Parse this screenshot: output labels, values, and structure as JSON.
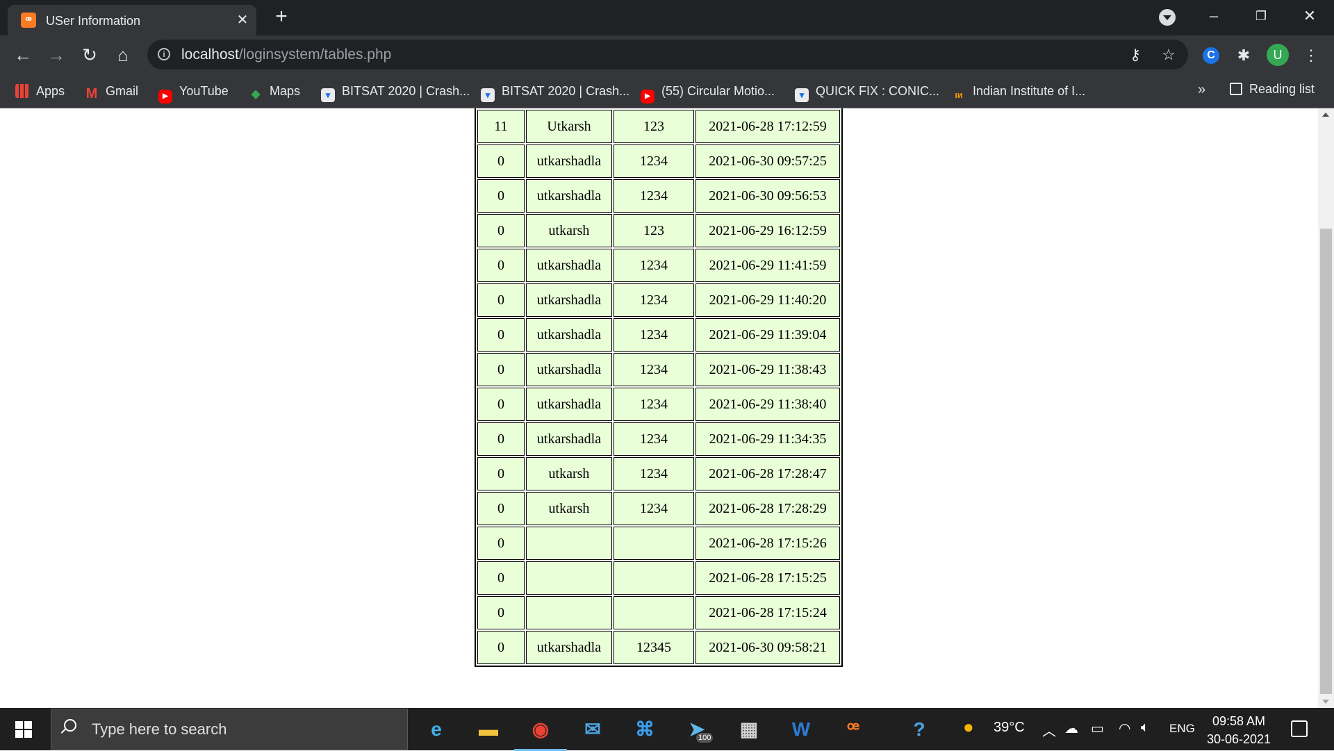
{
  "browser": {
    "tab": {
      "title": "USer Information"
    },
    "address": {
      "host": "localhost",
      "path": "/loginsystem/tables.php"
    },
    "bookmarks": [
      {
        "label": "Apps",
        "icon": "apps-grid-icon"
      },
      {
        "label": "Gmail",
        "icon": "gmail-icon"
      },
      {
        "label": "YouTube",
        "icon": "youtube-icon"
      },
      {
        "label": "Maps",
        "icon": "maps-icon"
      },
      {
        "label": "BITSAT 2020 | Crash...",
        "icon": "bookmark-site-icon"
      },
      {
        "label": "BITSAT 2020 | Crash...",
        "icon": "bookmark-site-icon"
      },
      {
        "label": "(55) Circular Motio...",
        "icon": "youtube-icon"
      },
      {
        "label": "QUICK FIX : CONIC...",
        "icon": "bookmark-site-icon"
      },
      {
        "label": "Indian Institute of I...",
        "icon": "iit-icon"
      }
    ],
    "bookmarks_more": "»",
    "reading_list": "Reading list",
    "profile_initial": "U"
  },
  "table": {
    "rows": [
      [
        "11",
        "Utkarsh",
        "123",
        "2021-06-28 17:12:59"
      ],
      [
        "0",
        "utkarshadla",
        "1234",
        "2021-06-30 09:57:25"
      ],
      [
        "0",
        "utkarshadla",
        "1234",
        "2021-06-30 09:56:53"
      ],
      [
        "0",
        "utkarsh",
        "123",
        "2021-06-29 16:12:59"
      ],
      [
        "0",
        "utkarshadla",
        "1234",
        "2021-06-29 11:41:59"
      ],
      [
        "0",
        "utkarshadla",
        "1234",
        "2021-06-29 11:40:20"
      ],
      [
        "0",
        "utkarshadla",
        "1234",
        "2021-06-29 11:39:04"
      ],
      [
        "0",
        "utkarshadla",
        "1234",
        "2021-06-29 11:38:43"
      ],
      [
        "0",
        "utkarshadla",
        "1234",
        "2021-06-29 11:38:40"
      ],
      [
        "0",
        "utkarshadla",
        "1234",
        "2021-06-29 11:34:35"
      ],
      [
        "0",
        "utkarsh",
        "1234",
        "2021-06-28 17:28:47"
      ],
      [
        "0",
        "utkarsh",
        "1234",
        "2021-06-28 17:28:29"
      ],
      [
        "0",
        "",
        "",
        "2021-06-28 17:15:26"
      ],
      [
        "0",
        "",
        "",
        "2021-06-28 17:15:25"
      ],
      [
        "0",
        "",
        "",
        "2021-06-28 17:15:24"
      ],
      [
        "0",
        "utkarshadla",
        "12345",
        "2021-06-30 09:58:21"
      ]
    ]
  },
  "taskbar": {
    "search_placeholder": "Type here to search",
    "telegram_badge": "100",
    "weather": "39°C",
    "language": "ENG",
    "time": "09:58 AM",
    "date": "30-06-2021"
  },
  "colors": {
    "cell_background": "#e8ffd8",
    "chrome_dark": "#202124",
    "chrome_toolbar": "#35363a",
    "xampp_orange": "#fb7a24"
  }
}
